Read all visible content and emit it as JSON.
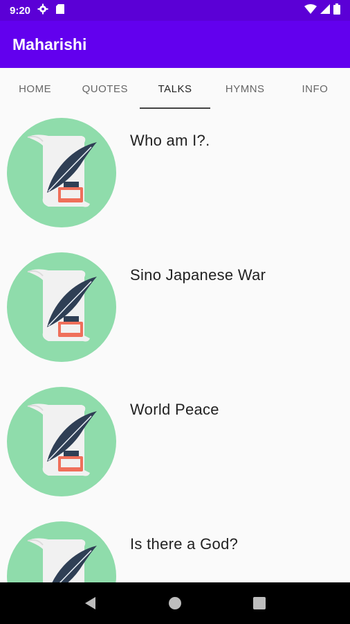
{
  "status_bar": {
    "time": "9:20",
    "icons": [
      "gear-icon",
      "sd-card-icon",
      "wifi-icon",
      "signal-icon",
      "battery-icon"
    ]
  },
  "app_bar": {
    "title": "Maharishi"
  },
  "tabs": [
    {
      "label": "HOME",
      "active": false
    },
    {
      "label": "QUOTES",
      "active": false
    },
    {
      "label": "TALKS",
      "active": true
    },
    {
      "label": "HYMNS",
      "active": false
    },
    {
      "label": "INFO",
      "active": false
    }
  ],
  "talks": [
    {
      "title": "Who am I?.",
      "icon": "scroll-quill-icon"
    },
    {
      "title": "Sino Japanese War",
      "icon": "scroll-quill-icon"
    },
    {
      "title": "World Peace",
      "icon": "scroll-quill-icon"
    },
    {
      "title": "Is there a God?",
      "icon": "scroll-quill-icon"
    }
  ],
  "colors": {
    "status_bar": "#5b00d6",
    "app_bar": "#6200ee",
    "thumb_bg": "#8fdcab",
    "quill": "#2f3f55",
    "ink_pot": "#ef6f5a"
  },
  "nav": {
    "icons": [
      "back-icon",
      "home-icon",
      "recents-icon"
    ]
  }
}
